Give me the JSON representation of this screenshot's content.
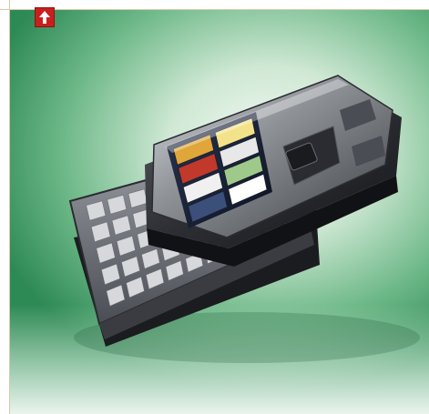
{
  "toolbar": {
    "scroll_top_icon": "arrow-up-icon",
    "accent_color": "#c8201e"
  },
  "image": {
    "background_colors": [
      "#2e8a55",
      "#cfe8d4",
      "#ffffff"
    ],
    "keyboard_rows": 5,
    "keys_per_row": 10,
    "screen_tiles": 8
  }
}
